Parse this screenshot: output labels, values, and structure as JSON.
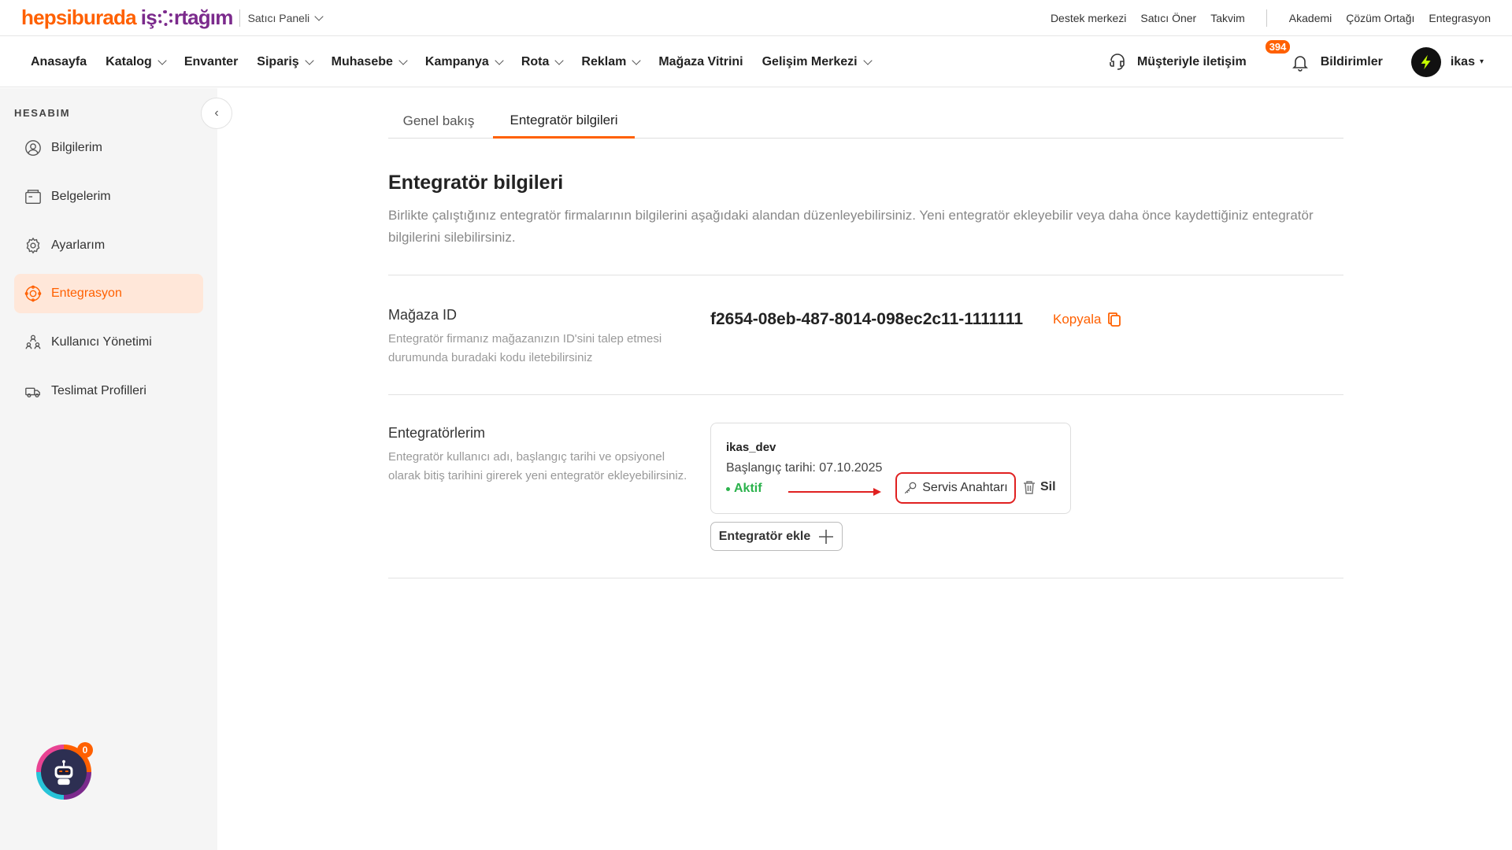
{
  "topbar": {
    "brand_part1": "hepsiburada",
    "brand_part2_a": "iş",
    "brand_part2_b": "rtağım",
    "panel_label": "Satıcı Paneli",
    "links": [
      "Destek merkezi",
      "Satıcı Öner",
      "Takvim",
      "Akademi",
      "Çözüm Ortağı",
      "Entegrasyon"
    ]
  },
  "nav": {
    "items": [
      {
        "label": "Anasayfa",
        "dropdown": false
      },
      {
        "label": "Katalog",
        "dropdown": true
      },
      {
        "label": "Envanter",
        "dropdown": false
      },
      {
        "label": "Sipariş",
        "dropdown": true
      },
      {
        "label": "Muhasebe",
        "dropdown": true
      },
      {
        "label": "Kampanya",
        "dropdown": true
      },
      {
        "label": "Rota",
        "dropdown": true
      },
      {
        "label": "Reklam",
        "dropdown": true
      },
      {
        "label": "Mağaza Vitrini",
        "dropdown": false
      },
      {
        "label": "Gelişim Merkezi",
        "dropdown": true
      }
    ],
    "contact_label": "Müşteriyle iletişim",
    "notifications_label": "Bildirimler",
    "notifications_count": "394",
    "user_name": "ikas"
  },
  "sidebar": {
    "title": "HESABIM",
    "items": [
      {
        "label": "Bilgilerim",
        "icon": "user-circle-icon",
        "active": false
      },
      {
        "label": "Belgelerim",
        "icon": "documents-icon",
        "active": false
      },
      {
        "label": "Ayarlarım",
        "icon": "gear-icon",
        "active": false
      },
      {
        "label": "Entegrasyon",
        "icon": "integration-icon",
        "active": true
      },
      {
        "label": "Kullanıcı Yönetimi",
        "icon": "users-icon",
        "active": false
      },
      {
        "label": "Teslimat Profilleri",
        "icon": "truck-icon",
        "active": false
      }
    ],
    "assistant_badge": "0"
  },
  "main": {
    "tabs": [
      {
        "label": "Genel bakış",
        "active": false
      },
      {
        "label": "Entegratör bilgileri",
        "active": true
      }
    ],
    "title": "Entegratör bilgileri",
    "description": "Birlikte çalıştığınız entegratör firmalarının bilgilerini aşağıdaki alandan düzenleyebilirsiniz. Yeni entegratör ekleyebilir veya daha önce kaydettiğiniz entegratör bilgilerini silebilirsiniz.",
    "store": {
      "label": "Mağaza ID",
      "description": "Entegratör firmanız mağazanızın ID'sini talep etmesi durumunda buradaki kodu iletebilirsiniz",
      "id_value": "f2654-08eb-487-8014-098ec2c11-1111111",
      "copy_label": "Kopyala"
    },
    "integrators": {
      "label": "Entegratörlerim",
      "description": "Entegratör kullanıcı adı, başlangıç tarihi ve opsiyonel olarak bitiş tarihini girerek yeni entegratör ekleyebilirsiniz.",
      "items": [
        {
          "name": "ikas_dev",
          "start_date": "Başlangıç tarihi: 07.10.2025",
          "status": "Aktif",
          "service_key_label": "Servis Anahtarı",
          "delete_label": "Sil"
        }
      ],
      "add_label": "Entegratör ekle"
    }
  },
  "colors": {
    "accent": "#ff6000",
    "brand_purple": "#7b2a8c",
    "status_green": "#2bb24c",
    "highlight_red": "#e02020"
  }
}
